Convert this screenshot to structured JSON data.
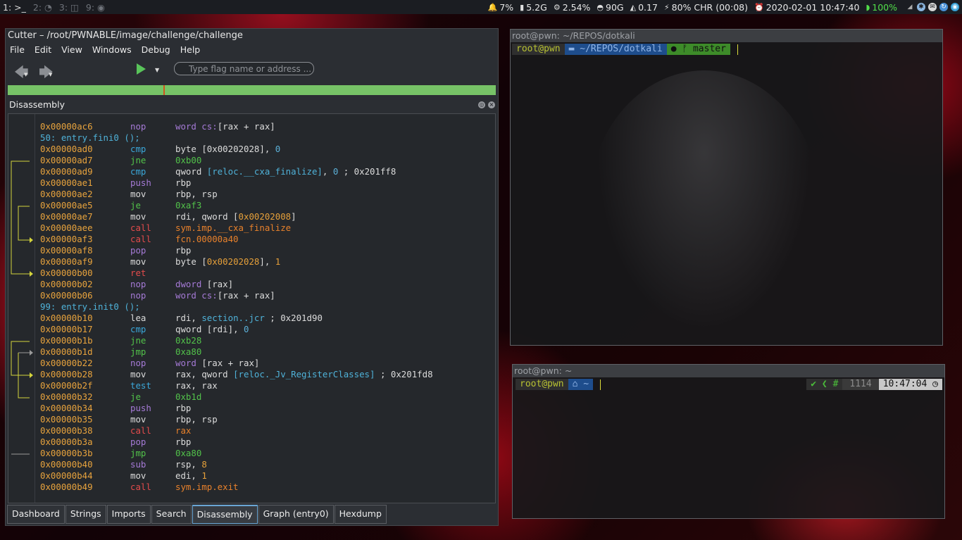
{
  "topbar": {
    "workspaces": [
      {
        "label": "1: >_",
        "active": true
      },
      {
        "label": "2: ◔",
        "active": false
      },
      {
        "label": "3: ◫",
        "active": false
      },
      {
        "label": "9: ◉",
        "active": false
      }
    ],
    "status": {
      "notify": "7%",
      "memory": "5.2G",
      "cpu": "2.54%",
      "disk": "90G",
      "load": "0.17",
      "battery": "80% CHR (00:08)",
      "datetime": "2020-02-01 10:47:40",
      "wifi": "100%"
    }
  },
  "cutter": {
    "title": "Cutter – /root/PWNABLE/image/challenge/challenge",
    "menu": [
      "File",
      "Edit",
      "View",
      "Windows",
      "Debug",
      "Help"
    ],
    "search_placeholder": "Type flag name or address ...",
    "dock_title": "Disassembly",
    "lines": [
      {
        "addr": "0x00000ac6",
        "op": "nop",
        "opc": "purple",
        "args": [
          {
            "t": "word cs:",
            "c": "purple"
          },
          {
            "t": "[rax + rax]",
            "c": "args"
          }
        ]
      },
      {
        "label": "50: entry.fini0 ();"
      },
      {
        "addr": "0x00000ad0",
        "op": "cmp",
        "opc": "blue",
        "args": [
          {
            "t": "byte ",
            "c": "args"
          },
          {
            "t": "[0x00202028]",
            "c": "args"
          },
          {
            "t": ", ",
            "c": "args"
          },
          {
            "t": "0",
            "c": "imm"
          }
        ]
      },
      {
        "addr": "0x00000ad7",
        "op": "jne",
        "opc": "green",
        "args": [
          {
            "t": "0xb00",
            "c": "green"
          }
        ]
      },
      {
        "addr": "0x00000ad9",
        "op": "cmp",
        "opc": "blue",
        "args": [
          {
            "t": "qword ",
            "c": "args"
          },
          {
            "t": "[reloc.__cxa_finalize]",
            "c": "func"
          },
          {
            "t": ", ",
            "c": "args"
          },
          {
            "t": "0",
            "c": "imm"
          },
          {
            "t": " ; 0x201ff8",
            "c": "cmt"
          }
        ]
      },
      {
        "addr": "0x00000ae1",
        "op": "push",
        "opc": "purple",
        "args": [
          {
            "t": "rbp",
            "c": "args"
          }
        ]
      },
      {
        "addr": "0x00000ae2",
        "op": "mov",
        "opc": "gray",
        "args": [
          {
            "t": "rbp, rsp",
            "c": "args"
          }
        ]
      },
      {
        "addr": "0x00000ae5",
        "op": "je",
        "opc": "green",
        "args": [
          {
            "t": "0xaf3",
            "c": "green"
          }
        ]
      },
      {
        "addr": "0x00000ae7",
        "op": "mov",
        "opc": "gray",
        "args": [
          {
            "t": "rdi, qword [",
            "c": "args"
          },
          {
            "t": "0x00202008",
            "c": "num"
          },
          {
            "t": "]",
            "c": "args"
          }
        ]
      },
      {
        "addr": "0x00000aee",
        "op": "call",
        "opc": "red",
        "args": [
          {
            "t": "sym.imp.__cxa_finalize",
            "c": "sym"
          }
        ]
      },
      {
        "addr": "0x00000af3",
        "op": "call",
        "opc": "red",
        "args": [
          {
            "t": "fcn.00000a40",
            "c": "sym"
          }
        ]
      },
      {
        "addr": "0x00000af8",
        "op": "pop",
        "opc": "purple",
        "args": [
          {
            "t": "rbp",
            "c": "args"
          }
        ]
      },
      {
        "addr": "0x00000af9",
        "op": "mov",
        "opc": "gray",
        "args": [
          {
            "t": "byte [",
            "c": "args"
          },
          {
            "t": "0x00202028",
            "c": "num"
          },
          {
            "t": "], ",
            "c": "args"
          },
          {
            "t": "1",
            "c": "num"
          }
        ]
      },
      {
        "addr": "0x00000b00",
        "op": "ret",
        "opc": "red",
        "args": []
      },
      {
        "addr": "0x00000b02",
        "op": "nop",
        "opc": "purple",
        "args": [
          {
            "t": "dword ",
            "c": "purple"
          },
          {
            "t": "[rax]",
            "c": "args"
          }
        ]
      },
      {
        "addr": "0x00000b06",
        "op": "nop",
        "opc": "purple",
        "args": [
          {
            "t": "word cs:",
            "c": "purple"
          },
          {
            "t": "[rax + rax]",
            "c": "args"
          }
        ]
      },
      {
        "label": "99: entry.init0 ();"
      },
      {
        "addr": "0x00000b10",
        "op": "lea",
        "opc": "gray",
        "args": [
          {
            "t": "rdi, ",
            "c": "args"
          },
          {
            "t": "section..jcr",
            "c": "func"
          },
          {
            "t": " ; 0x201d90",
            "c": "cmt"
          }
        ]
      },
      {
        "addr": "0x00000b17",
        "op": "cmp",
        "opc": "blue",
        "args": [
          {
            "t": "qword ",
            "c": "args"
          },
          {
            "t": "[rdi]",
            "c": "args"
          },
          {
            "t": ", ",
            "c": "args"
          },
          {
            "t": "0",
            "c": "imm"
          }
        ]
      },
      {
        "addr": "0x00000b1b",
        "op": "jne",
        "opc": "green",
        "args": [
          {
            "t": "0xb28",
            "c": "green"
          }
        ]
      },
      {
        "addr": "0x00000b1d",
        "op": "jmp",
        "opc": "green",
        "args": [
          {
            "t": "0xa80",
            "c": "green"
          }
        ]
      },
      {
        "addr": "0x00000b22",
        "op": "nop",
        "opc": "purple",
        "args": [
          {
            "t": "word ",
            "c": "purple"
          },
          {
            "t": "[rax + rax]",
            "c": "args"
          }
        ]
      },
      {
        "addr": "0x00000b28",
        "op": "mov",
        "opc": "gray",
        "args": [
          {
            "t": "rax, qword ",
            "c": "args"
          },
          {
            "t": "[reloc._Jv_RegisterClasses]",
            "c": "func"
          },
          {
            "t": " ; 0x201fd8",
            "c": "cmt"
          }
        ]
      },
      {
        "addr": "0x00000b2f",
        "op": "test",
        "opc": "blue",
        "args": [
          {
            "t": "rax, rax",
            "c": "args"
          }
        ]
      },
      {
        "addr": "0x00000b32",
        "op": "je",
        "opc": "green",
        "args": [
          {
            "t": "0xb1d",
            "c": "green"
          }
        ]
      },
      {
        "addr": "0x00000b34",
        "op": "push",
        "opc": "purple",
        "args": [
          {
            "t": "rbp",
            "c": "args"
          }
        ]
      },
      {
        "addr": "0x00000b35",
        "op": "mov",
        "opc": "gray",
        "args": [
          {
            "t": "rbp, rsp",
            "c": "args"
          }
        ]
      },
      {
        "addr": "0x00000b38",
        "op": "call",
        "opc": "red",
        "args": [
          {
            "t": "rax",
            "c": "sym"
          }
        ]
      },
      {
        "addr": "0x00000b3a",
        "op": "pop",
        "opc": "purple",
        "args": [
          {
            "t": "rbp",
            "c": "args"
          }
        ]
      },
      {
        "addr": "0x00000b3b",
        "op": "jmp",
        "opc": "green",
        "args": [
          {
            "t": "0xa80",
            "c": "green"
          }
        ]
      },
      {
        "addr": "0x00000b40",
        "op": "sub",
        "opc": "purple",
        "args": [
          {
            "t": "rsp, ",
            "c": "args"
          },
          {
            "t": "8",
            "c": "num"
          }
        ]
      },
      {
        "addr": "0x00000b44",
        "op": "mov",
        "opc": "gray",
        "args": [
          {
            "t": "edi, ",
            "c": "args"
          },
          {
            "t": "1",
            "c": "num"
          }
        ]
      },
      {
        "addr": "0x00000b49",
        "op": "call",
        "opc": "red",
        "args": [
          {
            "t": "sym.imp.exit",
            "c": "sym"
          }
        ]
      }
    ],
    "tabs": [
      {
        "label": "Dashboard",
        "active": false
      },
      {
        "label": "Strings",
        "active": false
      },
      {
        "label": "Imports",
        "active": false
      },
      {
        "label": "Search",
        "active": false
      },
      {
        "label": "Disassembly",
        "active": true
      },
      {
        "label": "Graph (entry0)",
        "active": false
      },
      {
        "label": "Hexdump",
        "active": false
      }
    ]
  },
  "term1": {
    "title": "root@pwn: ~/REPOS/dotkali",
    "user": "root@pwn",
    "path": "~/REPOS/dotkali",
    "git": "master"
  },
  "term2": {
    "title": "root@pwn: ~",
    "user": "root@pwn",
    "path": "~",
    "status": "✔ ❮ #",
    "history": "1114",
    "time": "10:47:04"
  }
}
